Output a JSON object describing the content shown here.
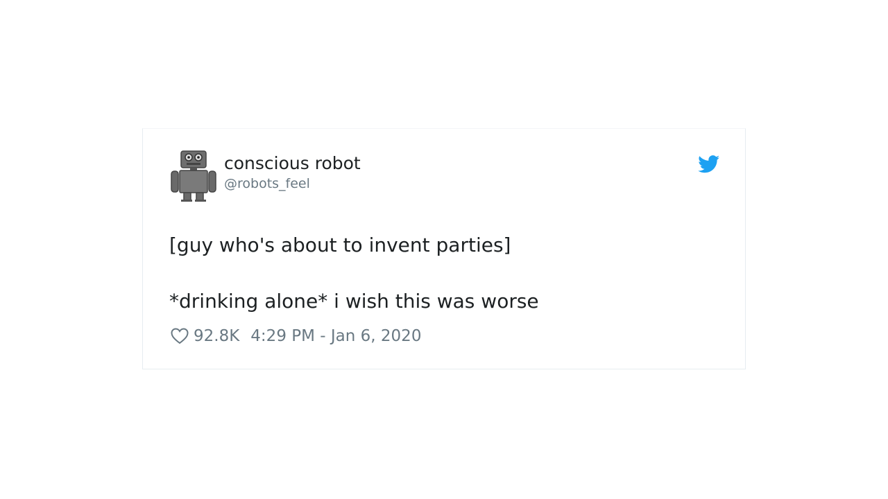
{
  "tweet": {
    "author": {
      "display_name": "conscious robot",
      "handle": "@robots_feel",
      "avatar": "robot-avatar"
    },
    "text_lines": [
      "[guy who's about to invent parties]",
      "*drinking alone* i wish this was worse"
    ],
    "likes": "92.8K",
    "timestamp": "4:29 PM - Jan 6, 2020",
    "icons": {
      "brand": "twitter-bird-icon",
      "like": "heart-icon"
    },
    "colors": {
      "brand": "#1da1f2",
      "text": "#1c2022",
      "muted": "#697882"
    }
  }
}
